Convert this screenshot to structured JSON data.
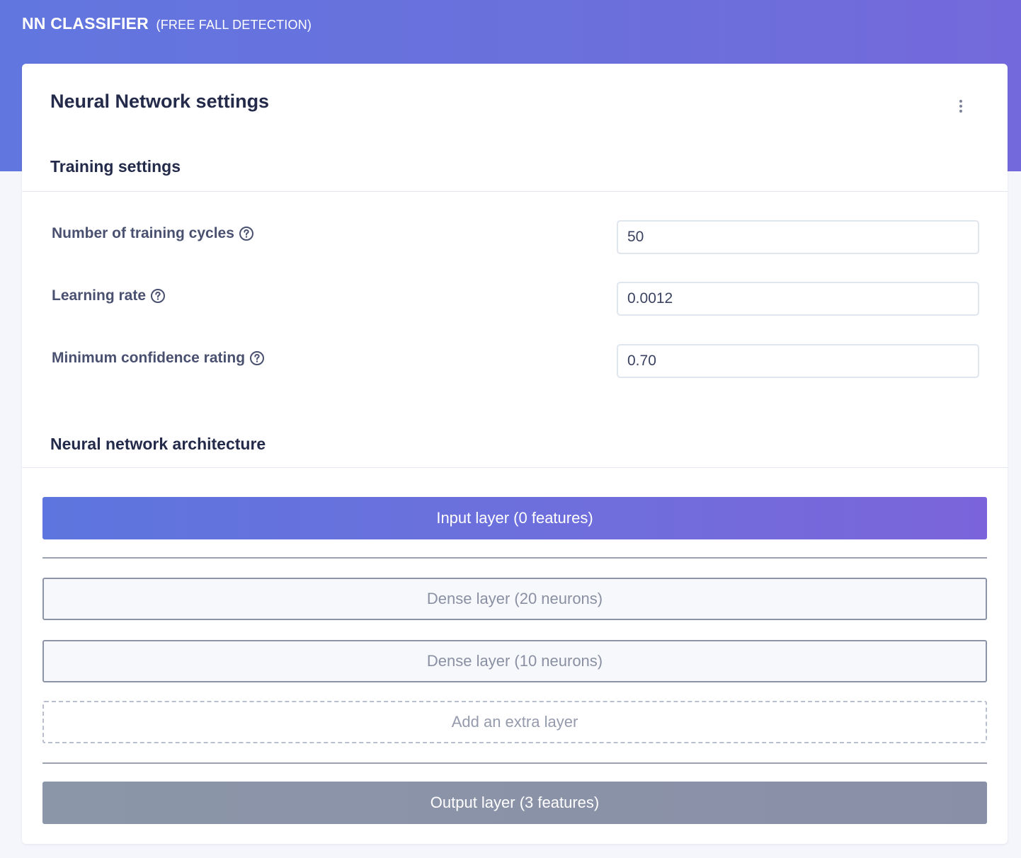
{
  "header": {
    "title": "NN CLASSIFIER",
    "subtitle": "(FREE FALL DETECTION)"
  },
  "card": {
    "title": "Neural Network settings",
    "menu_icon": "more-vertical-icon"
  },
  "training": {
    "section_title": "Training settings",
    "fields": [
      {
        "label": "Number of training cycles",
        "value": "50",
        "icon": "help-circle-icon"
      },
      {
        "label": "Learning rate",
        "value": "0.0012",
        "icon": "help-circle-icon"
      },
      {
        "label": "Minimum confidence rating",
        "value": "0.70",
        "icon": "help-circle-icon"
      }
    ]
  },
  "architecture": {
    "section_title": "Neural network architecture",
    "input_layer": "Input layer (0 features)",
    "dense_layers": [
      "Dense layer (20 neurons)",
      "Dense layer (10 neurons)"
    ],
    "add_layer": "Add an extra layer",
    "output_layer": "Output layer (3 features)"
  },
  "colors": {
    "header_gradient_start": "#6276df",
    "header_gradient_end": "#7469dc",
    "input_layer_start": "#5d75de",
    "input_layer_end": "#7b64db",
    "output_layer": "#8b93a8"
  }
}
